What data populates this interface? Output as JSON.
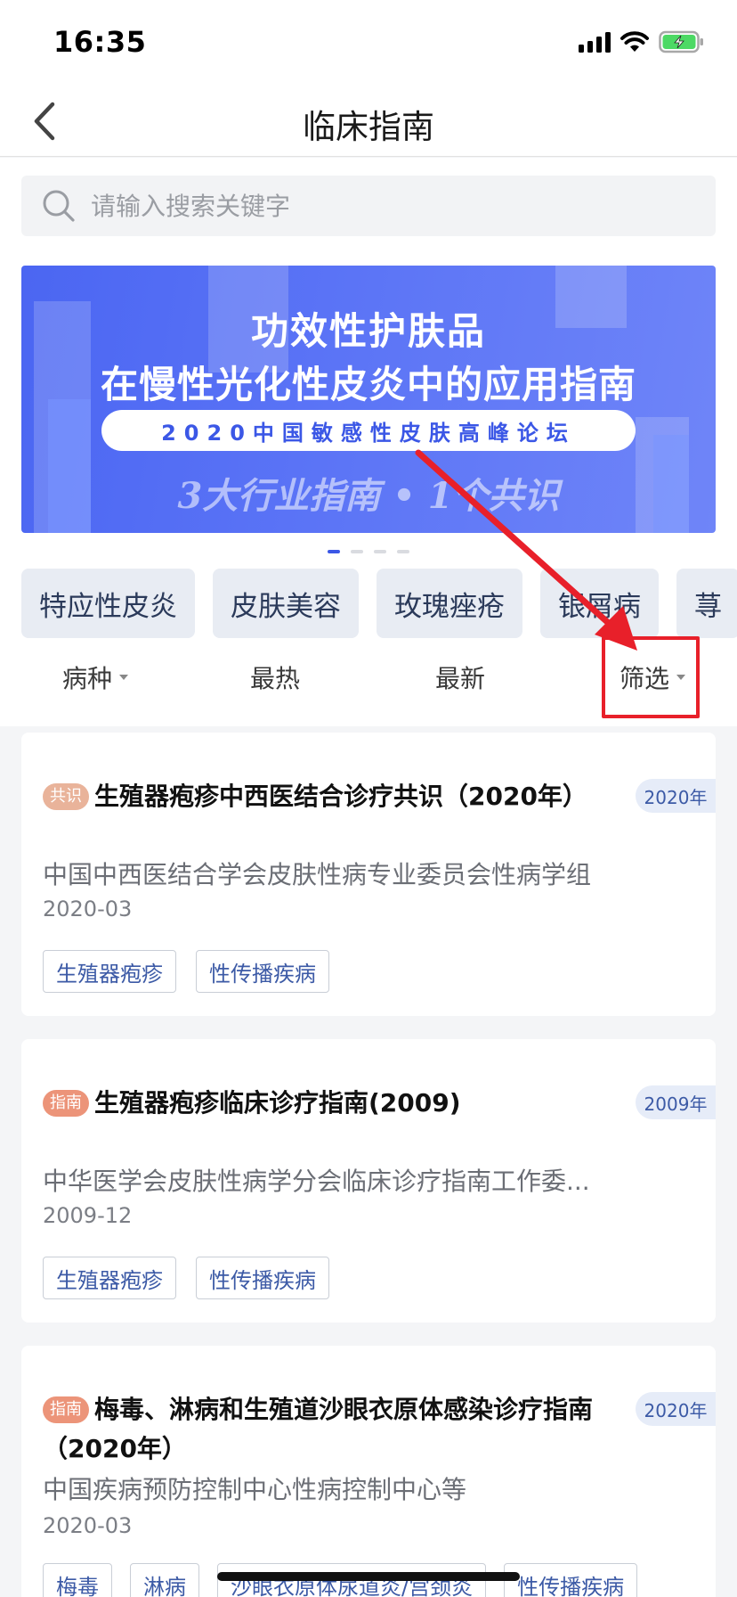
{
  "status_bar": {
    "time": "16:35"
  },
  "nav": {
    "title": "临床指南"
  },
  "search": {
    "placeholder": "请输入搜索关键字"
  },
  "banner": {
    "title_line1": "功效性护肤品",
    "title_line2": "在慢性光化性皮炎中的应用指南",
    "pill_text": "2020中国敏感性皮肤高峰论坛",
    "slogan": "3大行业指南 • 1个共识",
    "page_count": 4,
    "active_page": 1
  },
  "categories": [
    "特应性皮炎",
    "皮肤美容",
    "玫瑰痤疮",
    "银屑病",
    "荨"
  ],
  "sort_bar": {
    "disease": "病种",
    "hot": "最热",
    "latest": "最新",
    "filter": "筛选"
  },
  "guides": [
    {
      "badge": "共识",
      "title": "生殖器疱疹中西医结合诊疗共识（2020年）",
      "year": "2020年",
      "org": "中国中西医结合学会皮肤性病专业委员会性病学组",
      "date": "2020-03",
      "tags": [
        "生殖器疱疹",
        "性传播疾病"
      ]
    },
    {
      "badge": "指南",
      "title": "生殖器疱疹临床诊疗指南(2009)",
      "year": "2009年",
      "org": "中华医学会皮肤性病学分会临床诊疗指南工作委...",
      "date": "2009-12",
      "tags": [
        "生殖器疱疹",
        "性传播疾病"
      ]
    },
    {
      "badge": "指南",
      "title": "梅毒、淋病和生殖道沙眼衣原体感染诊疗指南（2020年）",
      "year": "2020年",
      "org": "中国疾病预防控制中心性病控制中心等",
      "date": "2020-03",
      "tags": [
        "梅毒",
        "淋病",
        "沙眼衣原体尿道炎/宫颈炎",
        "性传播疾病"
      ]
    }
  ],
  "colors": {
    "accent": "#3b57e6",
    "annotation": "#e8202a",
    "badge_consensus": "#e9b39a",
    "badge_guide": "#ec9479"
  },
  "icons": [
    "back-chevron-icon",
    "search-icon",
    "signal-icon",
    "wifi-icon",
    "battery-charging-icon",
    "caret-down-icon"
  ]
}
